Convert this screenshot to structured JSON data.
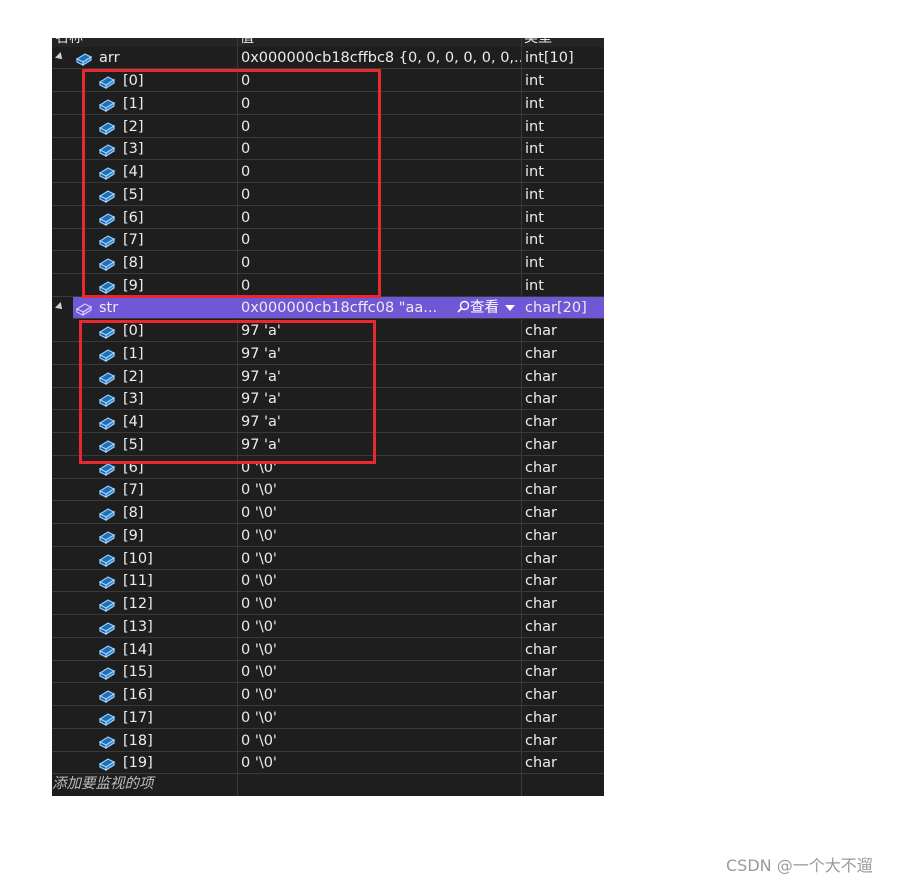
{
  "header": {
    "col_name": "名称",
    "col_value": "值",
    "col_type": "类型"
  },
  "arr": {
    "name": "arr",
    "value": "0x000000cb18cffbc8 {0, 0, 0, 0, 0, 0,...",
    "type": "int[10]"
  },
  "arr_items": [
    {
      "name": "[0]",
      "value": "0",
      "type": "int"
    },
    {
      "name": "[1]",
      "value": "0",
      "type": "int"
    },
    {
      "name": "[2]",
      "value": "0",
      "type": "int"
    },
    {
      "name": "[3]",
      "value": "0",
      "type": "int"
    },
    {
      "name": "[4]",
      "value": "0",
      "type": "int"
    },
    {
      "name": "[5]",
      "value": "0",
      "type": "int"
    },
    {
      "name": "[6]",
      "value": "0",
      "type": "int"
    },
    {
      "name": "[7]",
      "value": "0",
      "type": "int"
    },
    {
      "name": "[8]",
      "value": "0",
      "type": "int"
    },
    {
      "name": "[9]",
      "value": "0",
      "type": "int"
    }
  ],
  "str": {
    "name": "str",
    "value": "0x000000cb18cffc08 \"aa...",
    "lookup": "查看",
    "type": "char[20]"
  },
  "str_items": [
    {
      "name": "[0]",
      "value": "97 'a'",
      "type": "char"
    },
    {
      "name": "[1]",
      "value": "97 'a'",
      "type": "char"
    },
    {
      "name": "[2]",
      "value": "97 'a'",
      "type": "char"
    },
    {
      "name": "[3]",
      "value": "97 'a'",
      "type": "char"
    },
    {
      "name": "[4]",
      "value": "97 'a'",
      "type": "char"
    },
    {
      "name": "[5]",
      "value": "97 'a'",
      "type": "char"
    },
    {
      "name": "[6]",
      "value": "0 '\\0'",
      "type": "char"
    },
    {
      "name": "[7]",
      "value": "0 '\\0'",
      "type": "char"
    },
    {
      "name": "[8]",
      "value": "0 '\\0'",
      "type": "char"
    },
    {
      "name": "[9]",
      "value": "0 '\\0'",
      "type": "char"
    },
    {
      "name": "[10]",
      "value": "0 '\\0'",
      "type": "char"
    },
    {
      "name": "[11]",
      "value": "0 '\\0'",
      "type": "char"
    },
    {
      "name": "[12]",
      "value": "0 '\\0'",
      "type": "char"
    },
    {
      "name": "[13]",
      "value": "0 '\\0'",
      "type": "char"
    },
    {
      "name": "[14]",
      "value": "0 '\\0'",
      "type": "char"
    },
    {
      "name": "[15]",
      "value": "0 '\\0'",
      "type": "char"
    },
    {
      "name": "[16]",
      "value": "0 '\\0'",
      "type": "char"
    },
    {
      "name": "[17]",
      "value": "0 '\\0'",
      "type": "char"
    },
    {
      "name": "[18]",
      "value": "0 '\\0'",
      "type": "char"
    },
    {
      "name": "[19]",
      "value": "0 '\\0'",
      "type": "char"
    }
  ],
  "add_watch": "添加要监视的项",
  "watermark": "CSDN @一个大不遛",
  "colors": {
    "background": "#1e1e1e",
    "selected_row": "#6f57d6",
    "highlight_box": "#e8282f",
    "text": "#ececec"
  },
  "icons": {
    "variable": "object-variable-icon",
    "expand": "expander-triangle-icon"
  }
}
